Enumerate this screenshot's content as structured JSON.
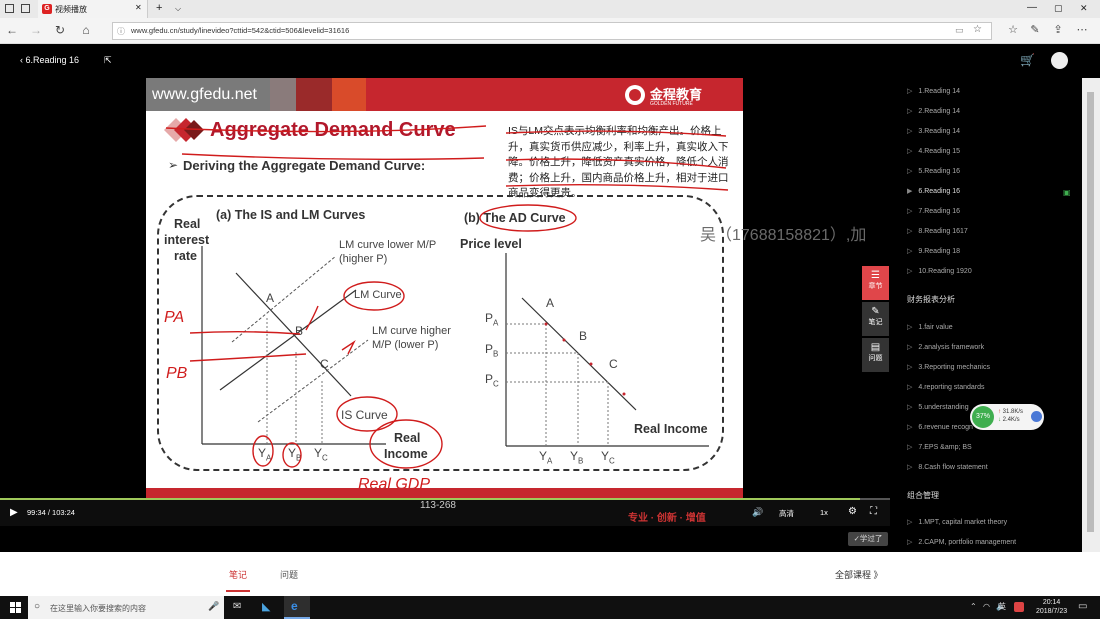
{
  "browser": {
    "tab_title": "视频播放",
    "tab_favicon": "G",
    "url": "www.gfedu.cn/study/linevideo?cttid=542&ctid=506&levelid=31616"
  },
  "site_header": {
    "back_label": "6.Reading 16"
  },
  "slide": {
    "site_url": "www.gfedu.net",
    "brand_cn": "金程教育",
    "brand_en": "GOLDEN FUTURE",
    "title": "Aggregate Demand Curve",
    "subtitle": "Deriving the Aggregate Demand Curve:",
    "note": "IS与LM交点表示均衡利率和均衡产出。价格上升，真实货币供应减少，利率上升，真实收入下降。价格上升，降低资产真实价格，降低个人消费；价格上升，国内商品价格上升，相对于进口商品变得更贵。",
    "left_panel": {
      "title": "(a) The IS and LM Curves",
      "ylabel_1": "Real",
      "ylabel_2": "interest",
      "ylabel_3": "rate",
      "lm_lower": "LM curve lower M/P",
      "lm_lower_2": "(higher P)",
      "lm_curve": "LM Curve",
      "lm_higher": "LM curve higher",
      "lm_higher_2": "M/P (lower P)",
      "is_curve": "IS Curve",
      "xlabel_1": "Real",
      "xlabel_2": "Income",
      "pt_a": "A",
      "pt_b": "B",
      "pt_c": "C",
      "x_ticks": [
        "Y",
        "Y",
        "Y"
      ],
      "x_tick_subs": [
        "A",
        "B",
        "C"
      ]
    },
    "right_panel": {
      "title": "(b) The AD Curve",
      "ylabel": "Price level",
      "xlabel": "Real Income",
      "pt_a": "A",
      "pt_b": "B",
      "pt_c": "C",
      "y_ticks": [
        "P",
        "P",
        "P"
      ],
      "y_tick_subs": [
        "A",
        "B",
        "C"
      ],
      "x_ticks": [
        "Y",
        "Y",
        "Y"
      ],
      "x_tick_subs": [
        "A",
        "B",
        "C"
      ]
    },
    "handwriting": {
      "pa": "PA",
      "pb": "PB",
      "real_gdp": "Real GDP"
    },
    "page_number": "113-268",
    "footer_slogan": "专业 · 创新 · 增值"
  },
  "player": {
    "time": "99:34 / 103:24",
    "quality": "高清",
    "speed": "1x",
    "learned_button": "✓学过了"
  },
  "side_buttons": [
    "章节",
    "笔记",
    "问题"
  ],
  "watermark": "吴（17688158821）,加",
  "network": {
    "percent": "37%",
    "up": "31.8K/s",
    "down": "2.4K/s"
  },
  "chapter_list": {
    "items_1": [
      "1.Reading 14",
      "2.Reading 14",
      "3.Reading 14",
      "4.Reading 15",
      "5.Reading 16",
      "6.Reading 16",
      "7.Reading 16",
      "8.Reading 1617",
      "9.Reading 18",
      "10.Reading 1920"
    ],
    "section_2": "财务报表分析",
    "items_2": [
      "1.fair value",
      "2.analysis framework",
      "3.Reporting mechanics",
      "4.reporting standards",
      "5.understanding",
      "6.revenue recogn",
      "7.EPS &amp; BS",
      "8.Cash flow statement"
    ],
    "section_3": "组合管理",
    "items_3": [
      "1.MPT, capital market theory",
      "2.CAPM, portfolio management"
    ]
  },
  "bottom_tabs": {
    "notes": "笔记",
    "questions": "问题",
    "all_courses": "全部课程 》"
  },
  "taskbar": {
    "search_placeholder": "在这里输入你要搜索的内容",
    "ime": "英",
    "time": "20:14",
    "date": "2018/7/23"
  },
  "colors": {
    "accent_red": "#c6262e",
    "title_red": "#b2182b",
    "progress_green": "#9fc95a"
  }
}
